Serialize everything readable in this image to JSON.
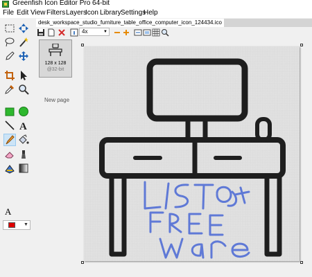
{
  "window": {
    "title": "Greenfish Icon Editor Pro 64-bit"
  },
  "menu": [
    "File",
    "Edit",
    "View",
    "Filters",
    "Layers",
    "Icon",
    "Library",
    "Settings",
    "Help"
  ],
  "tab": {
    "label": "desk_workspace_studio_furniture_table_office_computer_icon_124434.ico"
  },
  "toolbar": {
    "zoom": "4x"
  },
  "pages": {
    "thumb_size": "128 x 128",
    "thumb_depth": "@32-bit",
    "new_page": "New page"
  },
  "colors": {
    "primary": "#e00000",
    "canvas_grid": "#e4e4e4",
    "drawing": "#1e1e1e",
    "handwriting": "#5f79d6"
  },
  "canvas_text": [
    "LISTO",
    "FREE",
    "ware"
  ],
  "icons": [
    "rect-select-icon",
    "lasso-icon",
    "magic-wand-icon",
    "pencil-icon",
    "move-icon",
    "crop-icon",
    "pointer-icon",
    "eyedropper-icon",
    "zoom-icon",
    "rectangle-icon",
    "ellipse-icon",
    "line-icon",
    "text-icon",
    "brush-icon",
    "fill-icon",
    "eraser-icon",
    "smudge-icon",
    "recolor-icon",
    "gradient-icon"
  ]
}
